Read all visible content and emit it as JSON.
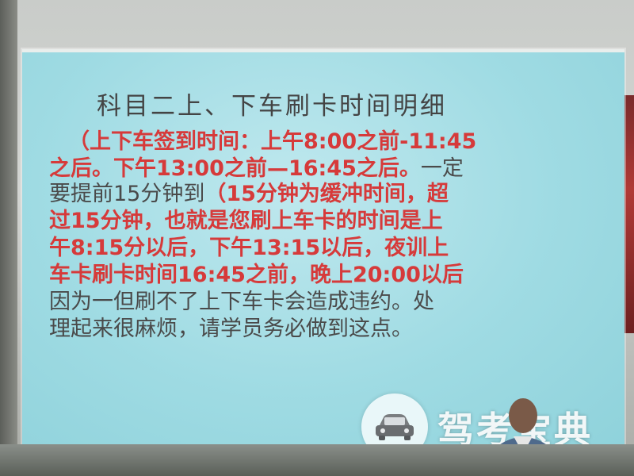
{
  "slide": {
    "title": "科目二上、下车刷卡时间明细",
    "lines": [
      [
        {
          "t": "（上下车签到时间：上午8:00之前-11:45",
          "c": "red"
        }
      ],
      [
        {
          "t": "之后。下午13:00之前—16:45之后。",
          "c": "red"
        },
        {
          "t": "一定",
          "c": "gray"
        }
      ],
      [
        {
          "t": "要提前15分钟到",
          "c": "gray"
        },
        {
          "t": "（15分钟为缓冲时间，超",
          "c": "red"
        }
      ],
      [
        {
          "t": "过15分钟，也就是您刷上车卡的时间是上",
          "c": "red"
        }
      ],
      [
        {
          "t": "午8:15分以后，下午13:15以后，夜训上",
          "c": "red"
        }
      ],
      [
        {
          "t": "车卡刷卡时间16:45之前，晚上20:00以后",
          "c": "red"
        }
      ],
      [
        {
          "t": "因为一但刷不了上下车卡会造成违约。处",
          "c": "gray"
        }
      ],
      [
        {
          "t": "理起来很麻烦，请学员务必做到这点。",
          "c": "gray"
        }
      ]
    ]
  },
  "watermark": {
    "text": "驾考宝典",
    "icon": "car-icon"
  },
  "colors": {
    "screen": "#9fdbe3",
    "highlight_text": "#d63a3a",
    "normal_text": "#4a4a4a"
  }
}
